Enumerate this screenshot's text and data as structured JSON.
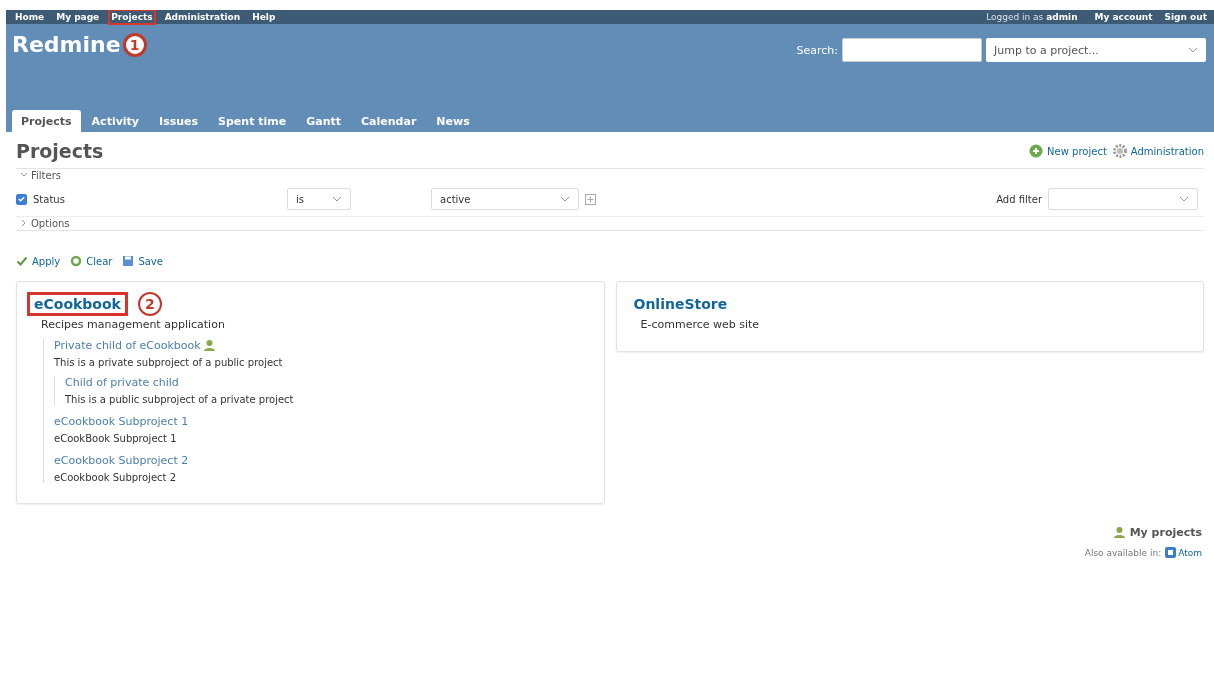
{
  "top_menu": [
    {
      "label": "Home",
      "highlighted": false
    },
    {
      "label": "My page",
      "highlighted": false
    },
    {
      "label": "Projects",
      "highlighted": true
    },
    {
      "label": "Administration",
      "highlighted": false
    },
    {
      "label": "Help",
      "highlighted": false
    }
  ],
  "account": {
    "logged_in_as": "Logged in as",
    "user": "admin",
    "links": [
      "My account",
      "Sign out"
    ]
  },
  "header": {
    "title": "Redmine",
    "callout": "1",
    "search_label": "Search:",
    "jump_placeholder": "Jump to a project..."
  },
  "tabs": [
    {
      "label": "Projects",
      "selected": true
    },
    {
      "label": "Activity",
      "selected": false
    },
    {
      "label": "Issues",
      "selected": false
    },
    {
      "label": "Spent time",
      "selected": false
    },
    {
      "label": "Gantt",
      "selected": false
    },
    {
      "label": "Calendar",
      "selected": false
    },
    {
      "label": "News",
      "selected": false
    }
  ],
  "page_title": "Projects",
  "contextual": [
    {
      "label": "New project",
      "kind": "add"
    },
    {
      "label": "Administration",
      "kind": "settings"
    }
  ],
  "filters": {
    "legend": "Filters",
    "expanded": true,
    "rows": [
      {
        "label": "Status",
        "checked": true,
        "operator": "is",
        "value": "active"
      }
    ],
    "add_filter_label": "Add filter"
  },
  "options": {
    "legend": "Options",
    "expanded": false
  },
  "actions": [
    {
      "label": "Apply",
      "kind": "apply"
    },
    {
      "label": "Clear",
      "kind": "clear"
    },
    {
      "label": "Save",
      "kind": "save"
    }
  ],
  "projects": [
    {
      "name": "eCookbook",
      "description": "Recipes management application",
      "highlighted": true,
      "callout": "2",
      "private": false,
      "children": [
        {
          "name": "Private child of eCookbook",
          "description": "This is a private subproject of a public project",
          "private": true,
          "children": [
            {
              "name": "Child of private child",
              "description": "This is a public subproject of a private project",
              "private": false
            }
          ]
        },
        {
          "name": "eCookbook Subproject 1",
          "description": "eCookBook Subproject 1",
          "private": false
        },
        {
          "name": "eCookbook Subproject 2",
          "description": "eCookbook Subproject 2",
          "private": false
        }
      ]
    },
    {
      "name": "OnlineStore",
      "description": "E-commerce web site",
      "highlighted": false,
      "private": false
    }
  ],
  "my_projects": "My projects",
  "also_available": "Also available in:",
  "formats": [
    "Atom"
  ]
}
